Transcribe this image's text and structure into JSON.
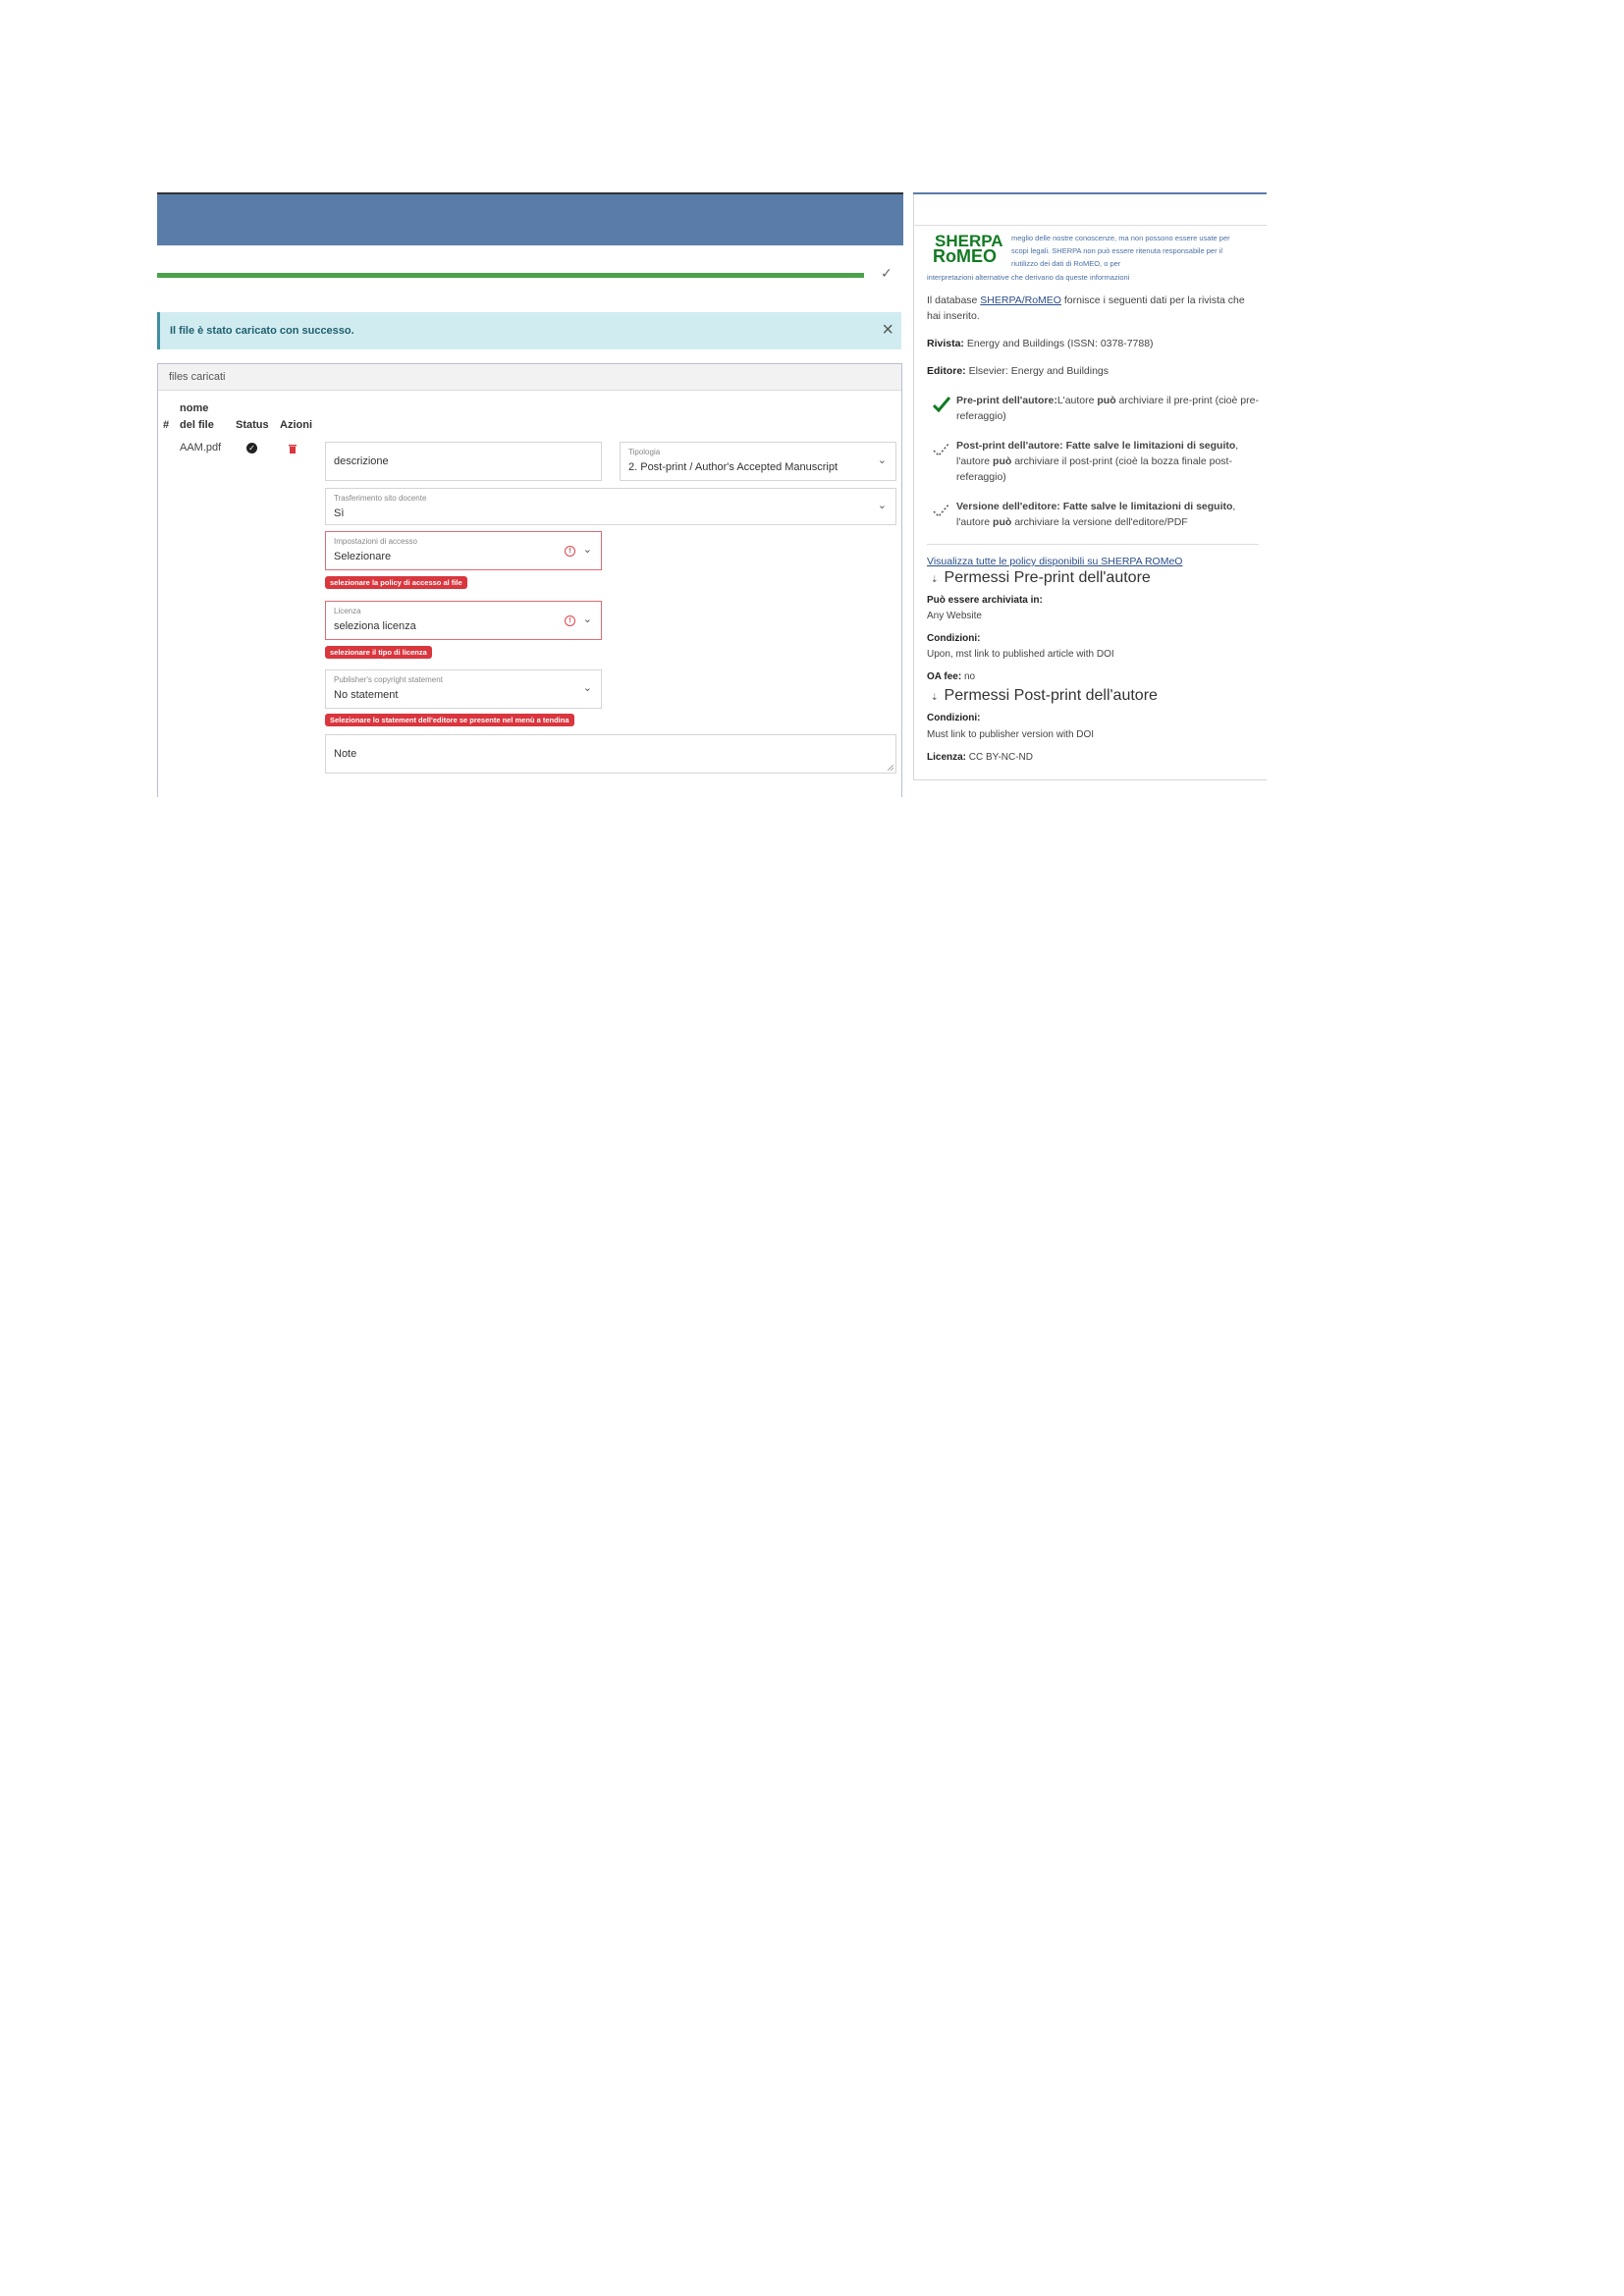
{
  "upload": {
    "progress_percent": 100,
    "alert_message": "Il file è stato caricato con successo.",
    "close_symbol": "×"
  },
  "files_table": {
    "heading": "files caricati",
    "columns": {
      "number": "#",
      "file_name": "nome del file",
      "status": "Status",
      "actions": "Azioni"
    },
    "rows": [
      {
        "file_name": "AAM.pdf",
        "status_icon": "check-circle-icon",
        "action_icon": "trash-icon"
      }
    ]
  },
  "form": {
    "descrizione_placeholder": "descrizione",
    "tipologia_label": "Tipologia",
    "tipologia_value": "2. Post-print / Author's Accepted Manuscript",
    "trasferimento_label": "Trasferimento sito docente",
    "trasferimento_value": "Sì",
    "accesso_label": "Impostazioni di accesso",
    "accesso_value": "Selezionare",
    "accesso_error": "selezionare la policy di accesso al file",
    "licenza_label": "Licenza",
    "licenza_value": "seleziona licenza",
    "licenza_error": "selezionare il tipo di licenza",
    "copyright_label": "Publisher's copyright statement",
    "copyright_value": "No statement",
    "copyright_error": "Selezionare lo statement dell'editore se presente nel menù a tendina",
    "note_placeholder": "Note"
  },
  "sherpa": {
    "logo_top": "SHERPA",
    "logo_bottom": "RoMEO",
    "disclaimer_a": "meglio delle nostre conoscenze, ma non possono essere usate per scopi legali. SHERPA non può essere ritenuta responsabile per il riutilizzo dei dati di RoMEO, o per",
    "disclaimer_b": "interpretazioni alternative che derivano da queste informazioni",
    "intro_pre": "Il database ",
    "intro_link": "SHERPA/RoMEO",
    "intro_post": " fornisce i seguenti dati per la rivista che hai inserito.",
    "rivista_label": "Rivista:",
    "rivista_value": " Energy and Buildings (ISSN: 0378-7788)",
    "editore_label": "Editore:",
    "editore_value": " Elsevier: Energy and Buildings",
    "preprint_label": "Pre-print dell'autore:",
    "preprint_text_1": "L'autore ",
    "preprint_bold": "può",
    "preprint_text_2": " archiviare il pre-print (cioè pre-referaggio)",
    "postprint_label": "Post-print dell'autore: Fatte salve le limitazioni di seguito",
    "postprint_text_1": ", l'autore ",
    "postprint_bold": "può",
    "postprint_text_2": " archiviare il post-print (cioè la bozza finale post-referaggio)",
    "version_label": "Versione dell'editore: Fatte salve le limitazioni di seguito",
    "version_text_1": ", l'autore ",
    "version_bold": "può",
    "version_text_2": " archiviare la versione dell'editore/PDF",
    "policy_link": "Visualizza tutte le policy disponibili su SHERPA ROMeO",
    "pre_section_title": "Permessi Pre-print dell'autore",
    "pre_archiviata_label": "Può essere archiviata in:",
    "pre_archiviata_value": "Any Website",
    "pre_condizioni_label": "Condizioni:",
    "pre_condizioni_value": "Upon, mst link to published article with DOI",
    "oa_fee_label": "OA fee:",
    "oa_fee_value": " no",
    "post_section_title": "Permessi Post-print dell'autore",
    "post_condizioni_label": "Condizioni:",
    "post_condizioni_value": "Must link to publisher version with DOI",
    "licenza_label": "Licenza:",
    "licenza_value": " CC BY-NC-ND",
    "colors": {
      "brand_green": "#127a23",
      "link_blue": "#2a4e8a",
      "header_blue": "#5a7ca9"
    }
  }
}
